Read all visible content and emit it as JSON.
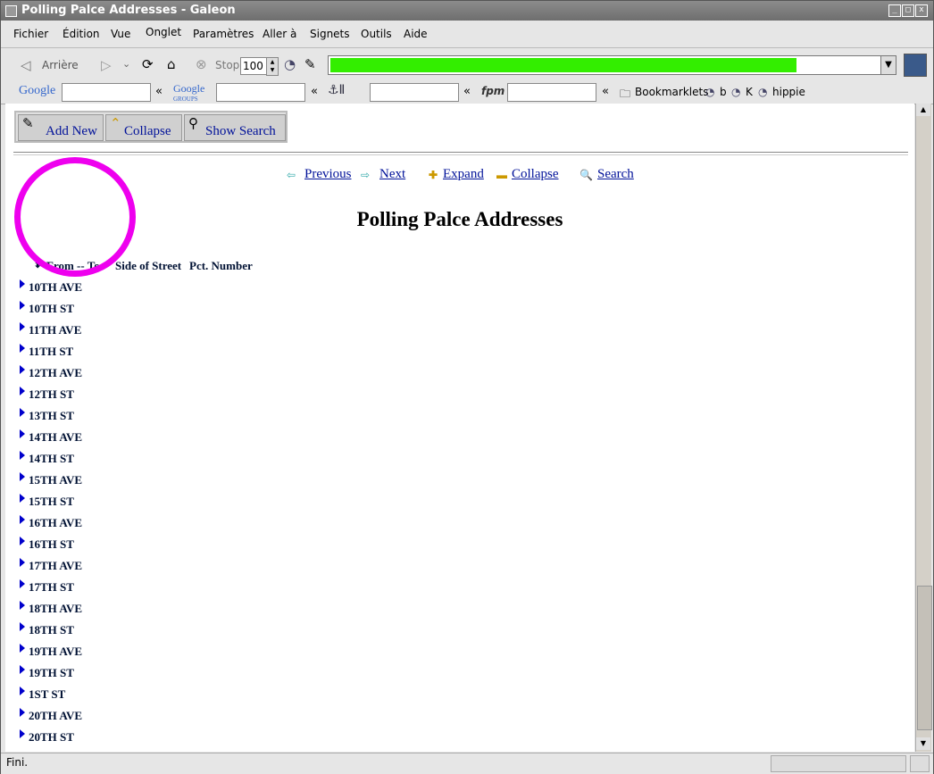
{
  "window": {
    "title": "Polling Palce Addresses - Galeon"
  },
  "menubar": {
    "items": [
      "Fichier",
      "Édition",
      "Vue",
      "Onglet",
      "Paramètres",
      "Aller à",
      "Signets",
      "Outils",
      "Aide"
    ]
  },
  "toolbar": {
    "back_label": "Arrière",
    "stop_label": "Stop",
    "zoom": "100",
    "load_progress": 0.85
  },
  "searchbar": {
    "separator": "«",
    "bookmarks": [
      "Bookmarklets",
      "b",
      "K",
      "hippie"
    ]
  },
  "page": {
    "buttons": {
      "add_new": "Add New",
      "collapse": "Collapse",
      "show_search": "Show Search"
    },
    "nav": {
      "previous": "Previous",
      "next": "Next",
      "expand": "Expand",
      "collapse": "Collapse",
      "search": "Search"
    },
    "title": "Polling Palce Addresses",
    "columns": {
      "from_to": "From -- To",
      "side": "Side of Street",
      "pct": "Pct. Number"
    },
    "streets": [
      "10TH AVE",
      "10TH ST",
      "11TH AVE",
      "11TH ST",
      "12TH AVE",
      "12TH ST",
      "13TH ST",
      "14TH AVE",
      "14TH ST",
      "15TH AVE",
      "15TH ST",
      "16TH AVE",
      "16TH ST",
      "17TH AVE",
      "17TH ST",
      "18TH AVE",
      "18TH ST",
      "19TH AVE",
      "19TH ST",
      "1ST ST",
      "20TH AVE",
      "20TH ST"
    ]
  },
  "status": {
    "text": "Fini."
  },
  "colors": {
    "link": "#001199",
    "annotation": "#ee00ee",
    "progress": "#33ee00"
  }
}
